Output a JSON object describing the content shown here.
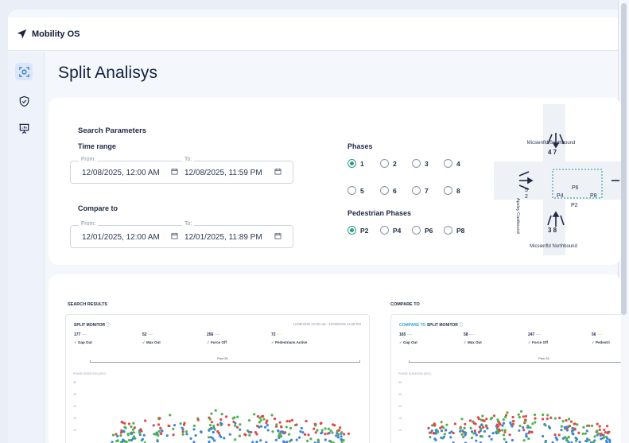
{
  "app": {
    "name": "Mobility OS"
  },
  "page": {
    "title": "Split Analisys"
  },
  "search": {
    "heading": "Search Parameters",
    "time_range_label": "Time range",
    "from_label": "From:",
    "to_label": "To:",
    "time_from": "12/08/2025, 12:00 AM",
    "time_to": "12/08/2025, 11:59 PM",
    "compare_label": "Compare to",
    "compare_from": "12/01/2025, 12:00 AM",
    "compare_to": "12/01/2025, 11:89 PM"
  },
  "phases": {
    "label": "Phases",
    "options": [
      "1",
      "2",
      "3",
      "4",
      "5",
      "6",
      "7",
      "8"
    ],
    "selected": "1"
  },
  "ped_phases": {
    "label": "Pedestrian Phases",
    "options": [
      "P2",
      "P4",
      "P6",
      "P8"
    ],
    "selected": "P2"
  },
  "intersection": {
    "north_label": "Micsienfld Southbound",
    "north_phases": "4 7",
    "south_label": "Micsienfld Northbound",
    "south_phases": "3 8",
    "west_label": "Apsley Castbound",
    "west_phases_top": "5",
    "west_phases_bottom": "2",
    "inner": [
      "P6",
      "P4",
      "P8",
      "P2"
    ]
  },
  "results": {
    "search_heading": "SEARCH RESULTS",
    "compare_heading": "COMPARE TO",
    "left": {
      "title": "SPLIT MONITOR",
      "range": "12/08/2025 12:00 AM - 12/08/2025 11:59 PM",
      "stats": [
        {
          "value": "177",
          "label": "Gap Out"
        },
        {
          "value": "52",
          "label": "Max Out"
        },
        {
          "value": "256",
          "label": "Force Off"
        },
        {
          "value": "72",
          "label": "Pedestrians Active"
        }
      ],
      "plan": "Plan 28",
      "y_axis_label": "PHASE DURATION (SEC)"
    },
    "right": {
      "title_prefix": "COMPARE TO",
      "title": "SPLIT MONITOR",
      "range": "12",
      "stats": [
        {
          "value": "165",
          "label": "Gap Out"
        },
        {
          "value": "58",
          "label": "Max Out"
        },
        {
          "value": "247",
          "label": "Force Off"
        },
        {
          "value": "56",
          "label": "Pedestri"
        }
      ],
      "plan": "Plan 28",
      "y_axis_label": "PHASE DURATION (SEC)"
    }
  },
  "colors": {
    "accent": "#2f9a8a",
    "gap_out": "#4fb34a",
    "max_out": "#e04848",
    "force_off": "#3f86d6",
    "ped": "#f0c93a"
  }
}
